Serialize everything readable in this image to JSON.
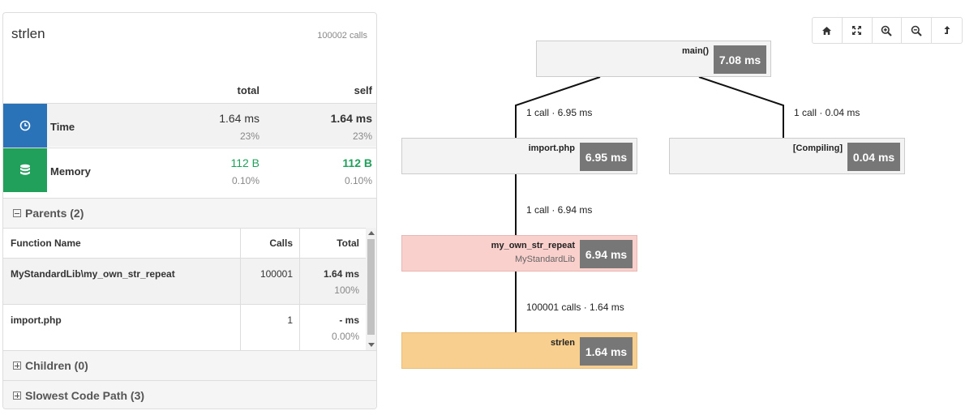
{
  "panel": {
    "title": "strlen",
    "calls": "100002 calls",
    "headers": {
      "total": "total",
      "self": "self"
    },
    "metrics": [
      {
        "label": "Time",
        "icon": "clock-icon",
        "total": "1.64 ms",
        "total_pct": "23%",
        "self": "1.64 ms",
        "self_pct": "23%"
      },
      {
        "label": "Memory",
        "icon": "database-icon",
        "total": "112 B",
        "total_pct": "0.10%",
        "self": "112 B",
        "self_pct": "0.10%"
      }
    ],
    "sections": {
      "parents": "Parents (2)",
      "children": "Children (0)",
      "slowest": "Slowest Code Path (3)"
    },
    "parents_table": {
      "headers": {
        "function": "Function Name",
        "calls": "Calls",
        "total": "Total"
      },
      "rows": [
        {
          "function": "MyStandardLib\\my_own_str_repeat",
          "calls": "100001",
          "total": "1.64 ms",
          "pct": "100%"
        },
        {
          "function": "import.php",
          "calls": "1",
          "total": "- ms",
          "pct": "0.00%"
        }
      ]
    }
  },
  "toolbar": [
    "home-icon",
    "fullscreen-icon",
    "zoom-in-icon",
    "zoom-out-icon",
    "export-icon"
  ],
  "graph": {
    "nodes": {
      "main": {
        "name": "main()",
        "time": "7.08 ms"
      },
      "import": {
        "name": "import.php",
        "time": "6.95 ms"
      },
      "compiling": {
        "name": "[Compiling]",
        "time": "0.04 ms"
      },
      "repeat": {
        "name": "my_own_str_repeat",
        "sub": "MyStandardLib",
        "time": "6.94 ms"
      },
      "strlen": {
        "name": "strlen",
        "time": "1.64 ms"
      }
    },
    "edges": {
      "main_import": "1 call · 6.95 ms",
      "main_compiling": "1 call · 0.04 ms",
      "import_repeat": "1 call · 6.94 ms",
      "repeat_strlen": "100001 calls · 1.64 ms"
    }
  },
  "colors": {
    "time": "#2a73b8",
    "memory": "#21a05c",
    "highlight_node": "#f9d0cc",
    "current_node": "#f8cf8e"
  }
}
